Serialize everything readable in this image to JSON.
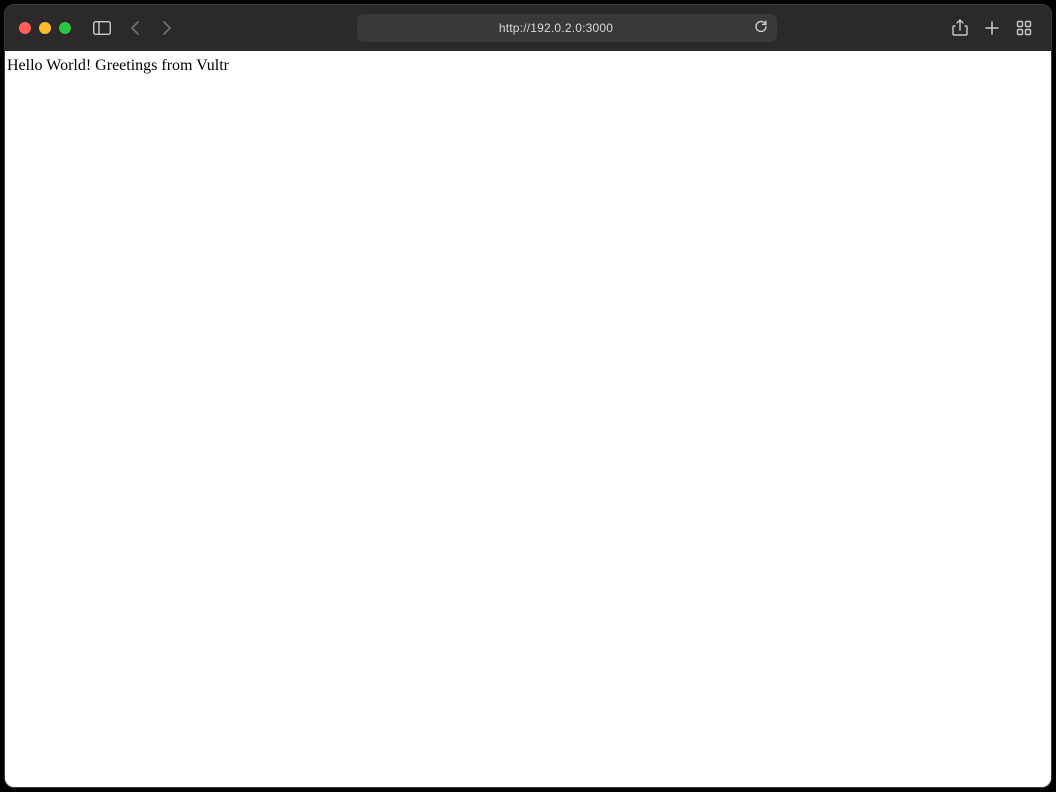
{
  "window": {
    "traffic_lights": {
      "close": "#ff5f57",
      "minimize": "#febc2e",
      "zoom": "#28c840"
    }
  },
  "toolbar": {
    "address_url": "http://192.0.2.0:3000",
    "icons": {
      "sidebar": "sidebar-icon",
      "back": "chevron-left-icon",
      "forward": "chevron-right-icon",
      "reload": "reload-icon",
      "share": "share-icon",
      "new_tab": "plus-icon",
      "tabs_overview": "grid-icon"
    }
  },
  "page": {
    "body_text": "Hello World! Greetings from Vultr"
  }
}
